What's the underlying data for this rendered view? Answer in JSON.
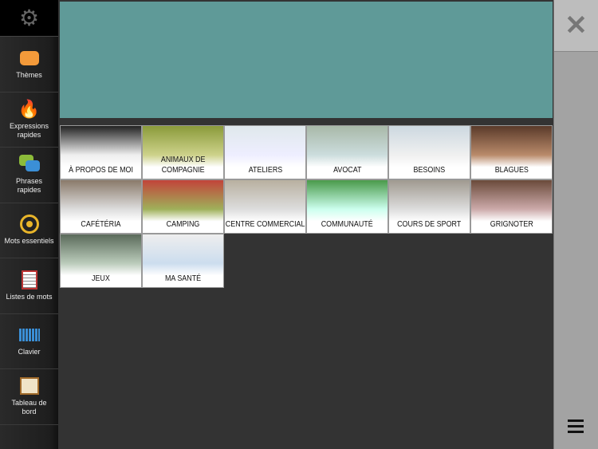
{
  "sidebar": {
    "items": [
      {
        "label": "Thèmes",
        "icon": "speech-bubble-icon"
      },
      {
        "label": "Expressions rapides",
        "icon": "flame-icon"
      },
      {
        "label": "Phrases rapides",
        "icon": "chat-bubbles-icon"
      },
      {
        "label": "Mots essentiels",
        "icon": "target-icon"
      },
      {
        "label": "Listes de mots",
        "icon": "notepad-icon"
      },
      {
        "label": "Clavier",
        "icon": "keyboard-icon"
      },
      {
        "label": "Tableau de bord",
        "icon": "board-icon"
      }
    ]
  },
  "tiles": [
    "À PROPOS DE MOI",
    "ANIMAUX DE\nCOMPAGNIE",
    "ATELIERS",
    "AVOCAT",
    "BESOINS",
    "BLAGUES",
    "CAFÉTÉRIA",
    "CAMPING",
    "CENTRE COMMERCIAL",
    "COMMUNAUTÉ",
    "COURS DE SPORT",
    "GRIGNOTER",
    "JEUX",
    "MA SANTÉ"
  ],
  "colors": {
    "display": "#5f9a98"
  }
}
